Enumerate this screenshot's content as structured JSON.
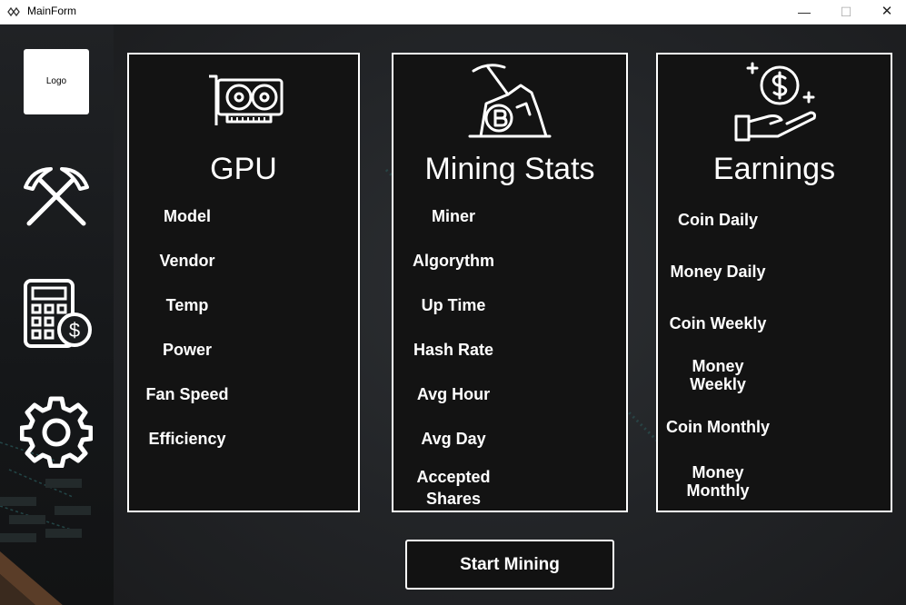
{
  "window": {
    "title": "MainForm",
    "minimize": "—",
    "maximize": "☐",
    "close": "✕"
  },
  "sidebar": {
    "logo_label": "Logo",
    "items": [
      {
        "name": "mining",
        "icon": "pickaxes-icon"
      },
      {
        "name": "calculator",
        "icon": "calculator-icon"
      },
      {
        "name": "settings",
        "icon": "gear-icon"
      }
    ]
  },
  "gpu": {
    "title": "GPU",
    "items": [
      "Model",
      "Vendor",
      "Temp",
      "Power",
      "Fan Speed",
      "Efficiency"
    ]
  },
  "mining": {
    "title": "Mining Stats",
    "items": [
      "Miner",
      "Algorythm",
      "Up Time",
      "Hash Rate",
      "Avg Hour",
      "Avg Day",
      "Accepted\nShares"
    ]
  },
  "earnings": {
    "title": "Earnings",
    "items": [
      "Coin Daily",
      "Money Daily",
      "Coin Weekly",
      "Money\nWeekly",
      "Coin Monthly",
      "Money\nMonthly"
    ]
  },
  "start_button": "Start Mining",
  "colors": {
    "accent": "#ffffff",
    "panel_bg": "#131313",
    "background": "#1e2022",
    "pattern": "#2f7a78"
  }
}
